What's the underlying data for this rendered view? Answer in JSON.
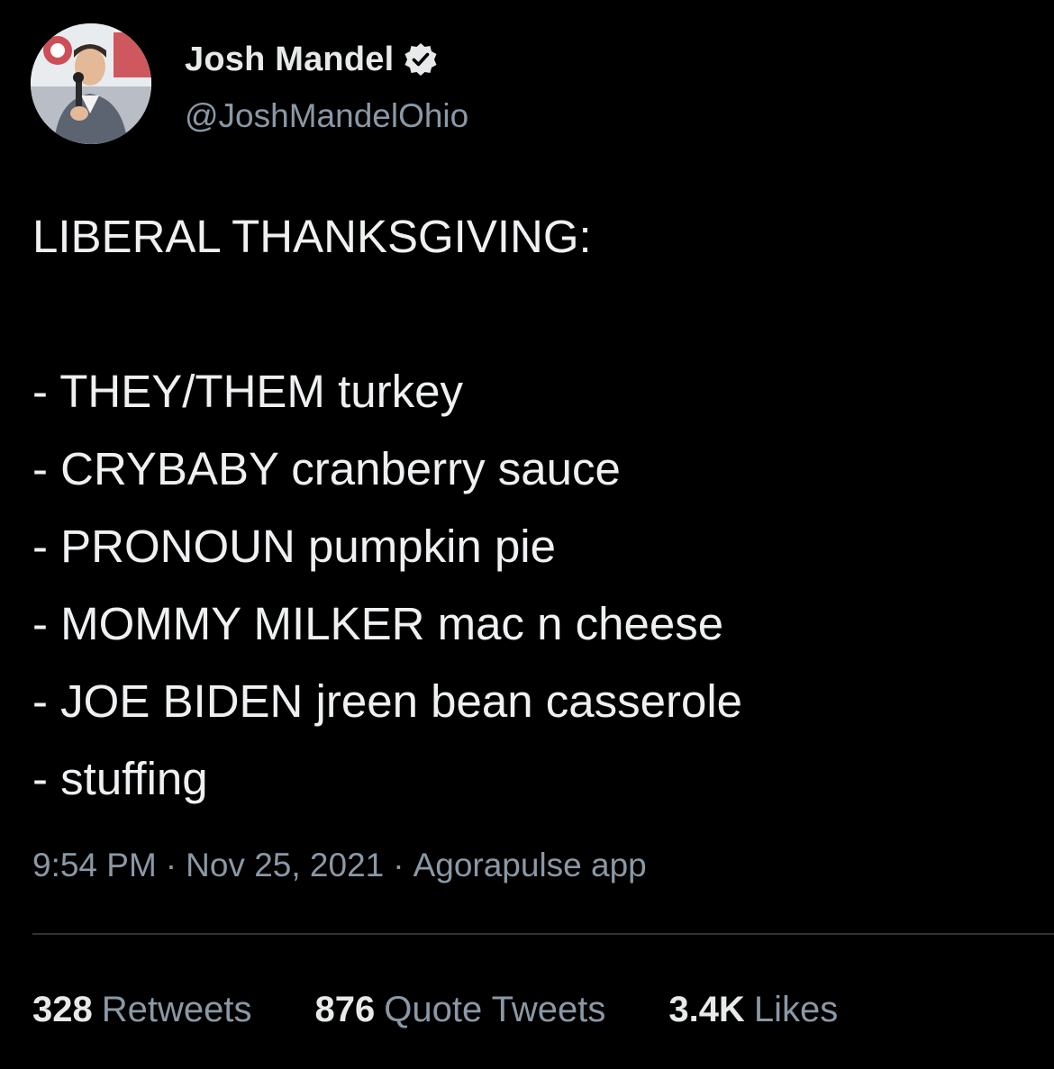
{
  "author": {
    "display_name": "Josh Mandel",
    "handle": "@JoshMandelOhio",
    "verified_icon": "verified-badge-icon",
    "avatar_icon": "profile-photo"
  },
  "tweet": {
    "headline": "LIBERAL THANKSGIVING:",
    "items": [
      "- THEY/THEM turkey",
      "- CRYBABY cranberry sauce",
      "- PRONOUN pumpkin pie",
      "- MOMMY MILKER mac n cheese",
      "- JOE BIDEN jreen bean casserole",
      "- stuffing"
    ]
  },
  "meta": {
    "time": "9:54 PM",
    "separator": "·",
    "date": "Nov 25, 2021",
    "source": "Agorapulse app"
  },
  "stats": {
    "retweets": {
      "count": "328",
      "label": "Retweets"
    },
    "quotes": {
      "count": "876",
      "label": "Quote Tweets"
    },
    "likes": {
      "count": "3.4K",
      "label": "Likes"
    }
  },
  "colors": {
    "background": "#000000",
    "primary_text": "#e7e9ea",
    "secondary_text": "#8b98a5",
    "divider": "#2f3336"
  }
}
